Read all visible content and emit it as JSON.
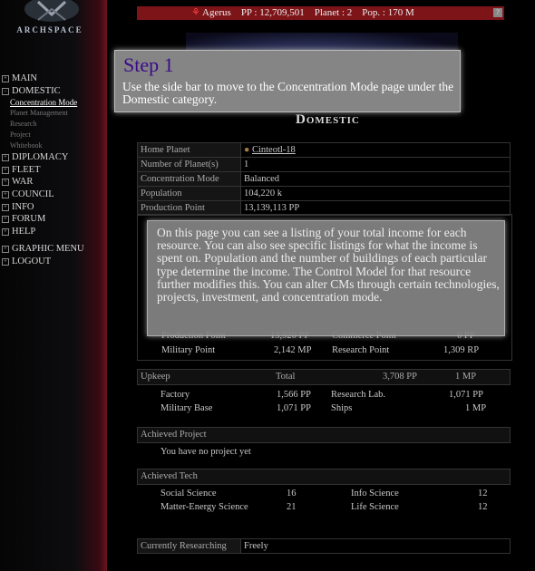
{
  "app": {
    "logo_text": "ARCHSPACE"
  },
  "topbar": {
    "name": "Agerus",
    "pp": "PP : 12,709,501",
    "planet": "Planet : 2",
    "pop": "Pop. : 170 M",
    "help": "?"
  },
  "sidebar": {
    "main": "MAIN",
    "domestic": "DOMESTIC",
    "domestic_sub": [
      "Concentration Mode",
      "Planet Management",
      "Research",
      "Project",
      "Whitebook"
    ],
    "diplomacy": "DIPLOMACY",
    "fleet": "FLEET",
    "war": "WAR",
    "council": "COUNCIL",
    "info": "INFO",
    "forum": "FORUM",
    "help": "HELP",
    "graphic_menu": "GRAPHIC MENU",
    "logout": "LOGOUT"
  },
  "page": {
    "heading": "Domestic"
  },
  "overview": {
    "rows": [
      {
        "label": "Home Planet",
        "value": "Cinteotl-18"
      },
      {
        "label": "Number of Planet(s)",
        "value": "1"
      },
      {
        "label": "Concentration Mode",
        "value": "Balanced"
      },
      {
        "label": "Population",
        "value": "104,220 k"
      },
      {
        "label": "Production Point",
        "value": "13,139,113 PP"
      }
    ]
  },
  "income_partial": {
    "production_label": "Production Point",
    "production_value": "13,920 PP",
    "commerce_label": "Commerce Point",
    "commerce_value": "0 PP",
    "military_label": "Military Point",
    "military_value": "2,142 MP",
    "research_label": "Research Point",
    "research_value": "1,309 RP"
  },
  "upkeep": {
    "header": "Upkeep",
    "total_label": "Total",
    "total_pp": "3,708 PP",
    "total_mp": "1 MP",
    "factory_label": "Factory",
    "factory_value": "1,566 PP",
    "research_lab_label": "Research Lab.",
    "research_lab_value": "1,071 PP",
    "military_base_label": "Military Base",
    "military_base_value": "1,071 PP",
    "ships_label": "Ships",
    "ships_value": "1 MP"
  },
  "achieved_project": {
    "header": "Achieved Project",
    "text": "You have no project yet"
  },
  "achieved_tech": {
    "header": "Achieved Tech",
    "social_label": "Social Science",
    "social_value": "16",
    "info_label": "Info Science",
    "info_value": "12",
    "matter_label": "Matter-Energy Science",
    "matter_value": "21",
    "life_label": "Life Science",
    "life_value": "12"
  },
  "researching": {
    "label": "Currently Researching",
    "value": "Freely"
  },
  "tip1": {
    "title": "Step 1",
    "body": "Use the side bar to move to the Concentration Mode page under the Domestic category."
  },
  "tip2": {
    "body": "On this page you can see a listing of your total income for each resource.  You can also see specific listings for what the income is spent on. Population and the number of buildings of each particular type determine the income. The Control Model for that resource further modifies this. You can alter CMs through certain technologies, projects, investment, and concentration mode."
  },
  "colors": {
    "topbar": "#7d1418",
    "tip_bg": "#858585",
    "step_title": "#3a0a8a"
  }
}
